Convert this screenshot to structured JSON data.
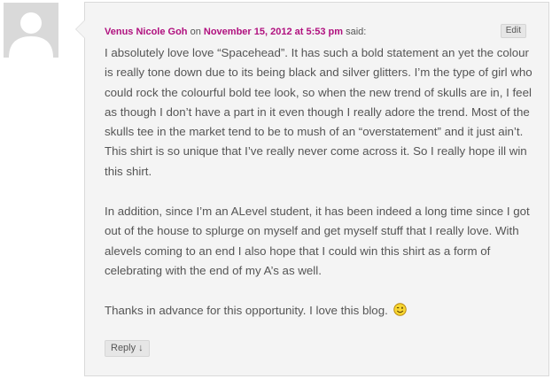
{
  "comment": {
    "author": "Venus Nicole Goh",
    "on_word": " on ",
    "date": "November 15, 2012 at 5:53 pm",
    "said_word": " said:",
    "edit_label": "Edit",
    "paragraph1": "I absolutely love love “Spacehead”. It has such a bold statement an yet the colour is really tone down due to its being black and silver glitters. I’m the type of girl who could rock the colourful bold tee look, so when the new trend of skulls are in, I feel as though I don’t have a part in it even though I really adore the trend. Most of the skulls tee in the market tend to be to mush of an “overstatement” and it just ain’t. This shirt is so unique that I’ve really never come across it. So I really hope ill win this shirt.",
    "paragraph2": "In addition, since I’m an ALevel student, it has been indeed a long time since I got out of the house to splurge on myself and get myself stuff that I really love. With alevels coming to an end I also hope that I could win this shirt as a form of celebrating with the end of my A’s as well.",
    "paragraph3": "Thanks in advance for this opportunity. I love this blog.",
    "smiley_icon": "wink-smiley-icon",
    "reply_label": "Reply ↓"
  },
  "avatar_icon": "default-avatar-icon",
  "colors": {
    "accent": "#b0117f",
    "text": "#555555",
    "box_bg": "#f4f4f4",
    "border": "#dadada",
    "avatar_bg": "#d9d9d9"
  }
}
